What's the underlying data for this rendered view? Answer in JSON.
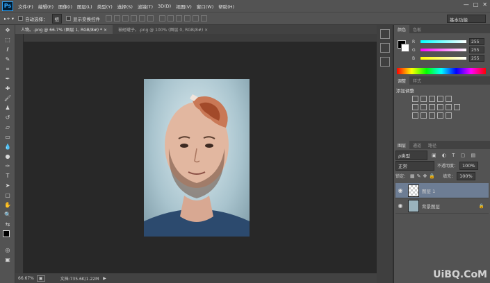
{
  "app": {
    "logo": "Ps"
  },
  "menu": [
    "文件(F)",
    "编辑(E)",
    "图像(I)",
    "图层(L)",
    "类型(Y)",
    "选择(S)",
    "滤镜(T)",
    "3D(D)",
    "视图(V)",
    "窗口(W)",
    "帮助(H)"
  ],
  "window_controls": [
    "—",
    "□",
    "✕"
  ],
  "options": {
    "auto_select_label": "自动选择：",
    "auto_select_value": "组",
    "show_transform_label": "显示变换控件",
    "workspace": "基本功能"
  },
  "tabs": [
    {
      "label": "人物。.png @ 66.7% (图层 1, RGB/8#) *  ×"
    },
    {
      "label": "被砸罐子。.png @ 100% (图层 0, RGB/8#)  ×"
    }
  ],
  "status": {
    "zoom": "66.67%",
    "doc": "文档:735.6K/1.22M"
  },
  "color_panel": {
    "tabs": [
      "颜色",
      "色板"
    ],
    "r": "255",
    "g": "255",
    "b": "255"
  },
  "adjust_panel": {
    "tabs": [
      "调整",
      "样式"
    ],
    "title": "添加调整"
  },
  "layers_panel": {
    "tabs": [
      "图层",
      "通道",
      "路径"
    ],
    "kind": "ρ类型",
    "blend": "正常",
    "opacity_label": "不透明度：",
    "opacity": "100%",
    "lock_label": "锁定：",
    "fill_label": "填充：",
    "fill": "100%",
    "layers": [
      {
        "name": "图层 1"
      },
      {
        "name": "背景图层"
      }
    ]
  },
  "watermark": "UiBQ.CoM"
}
